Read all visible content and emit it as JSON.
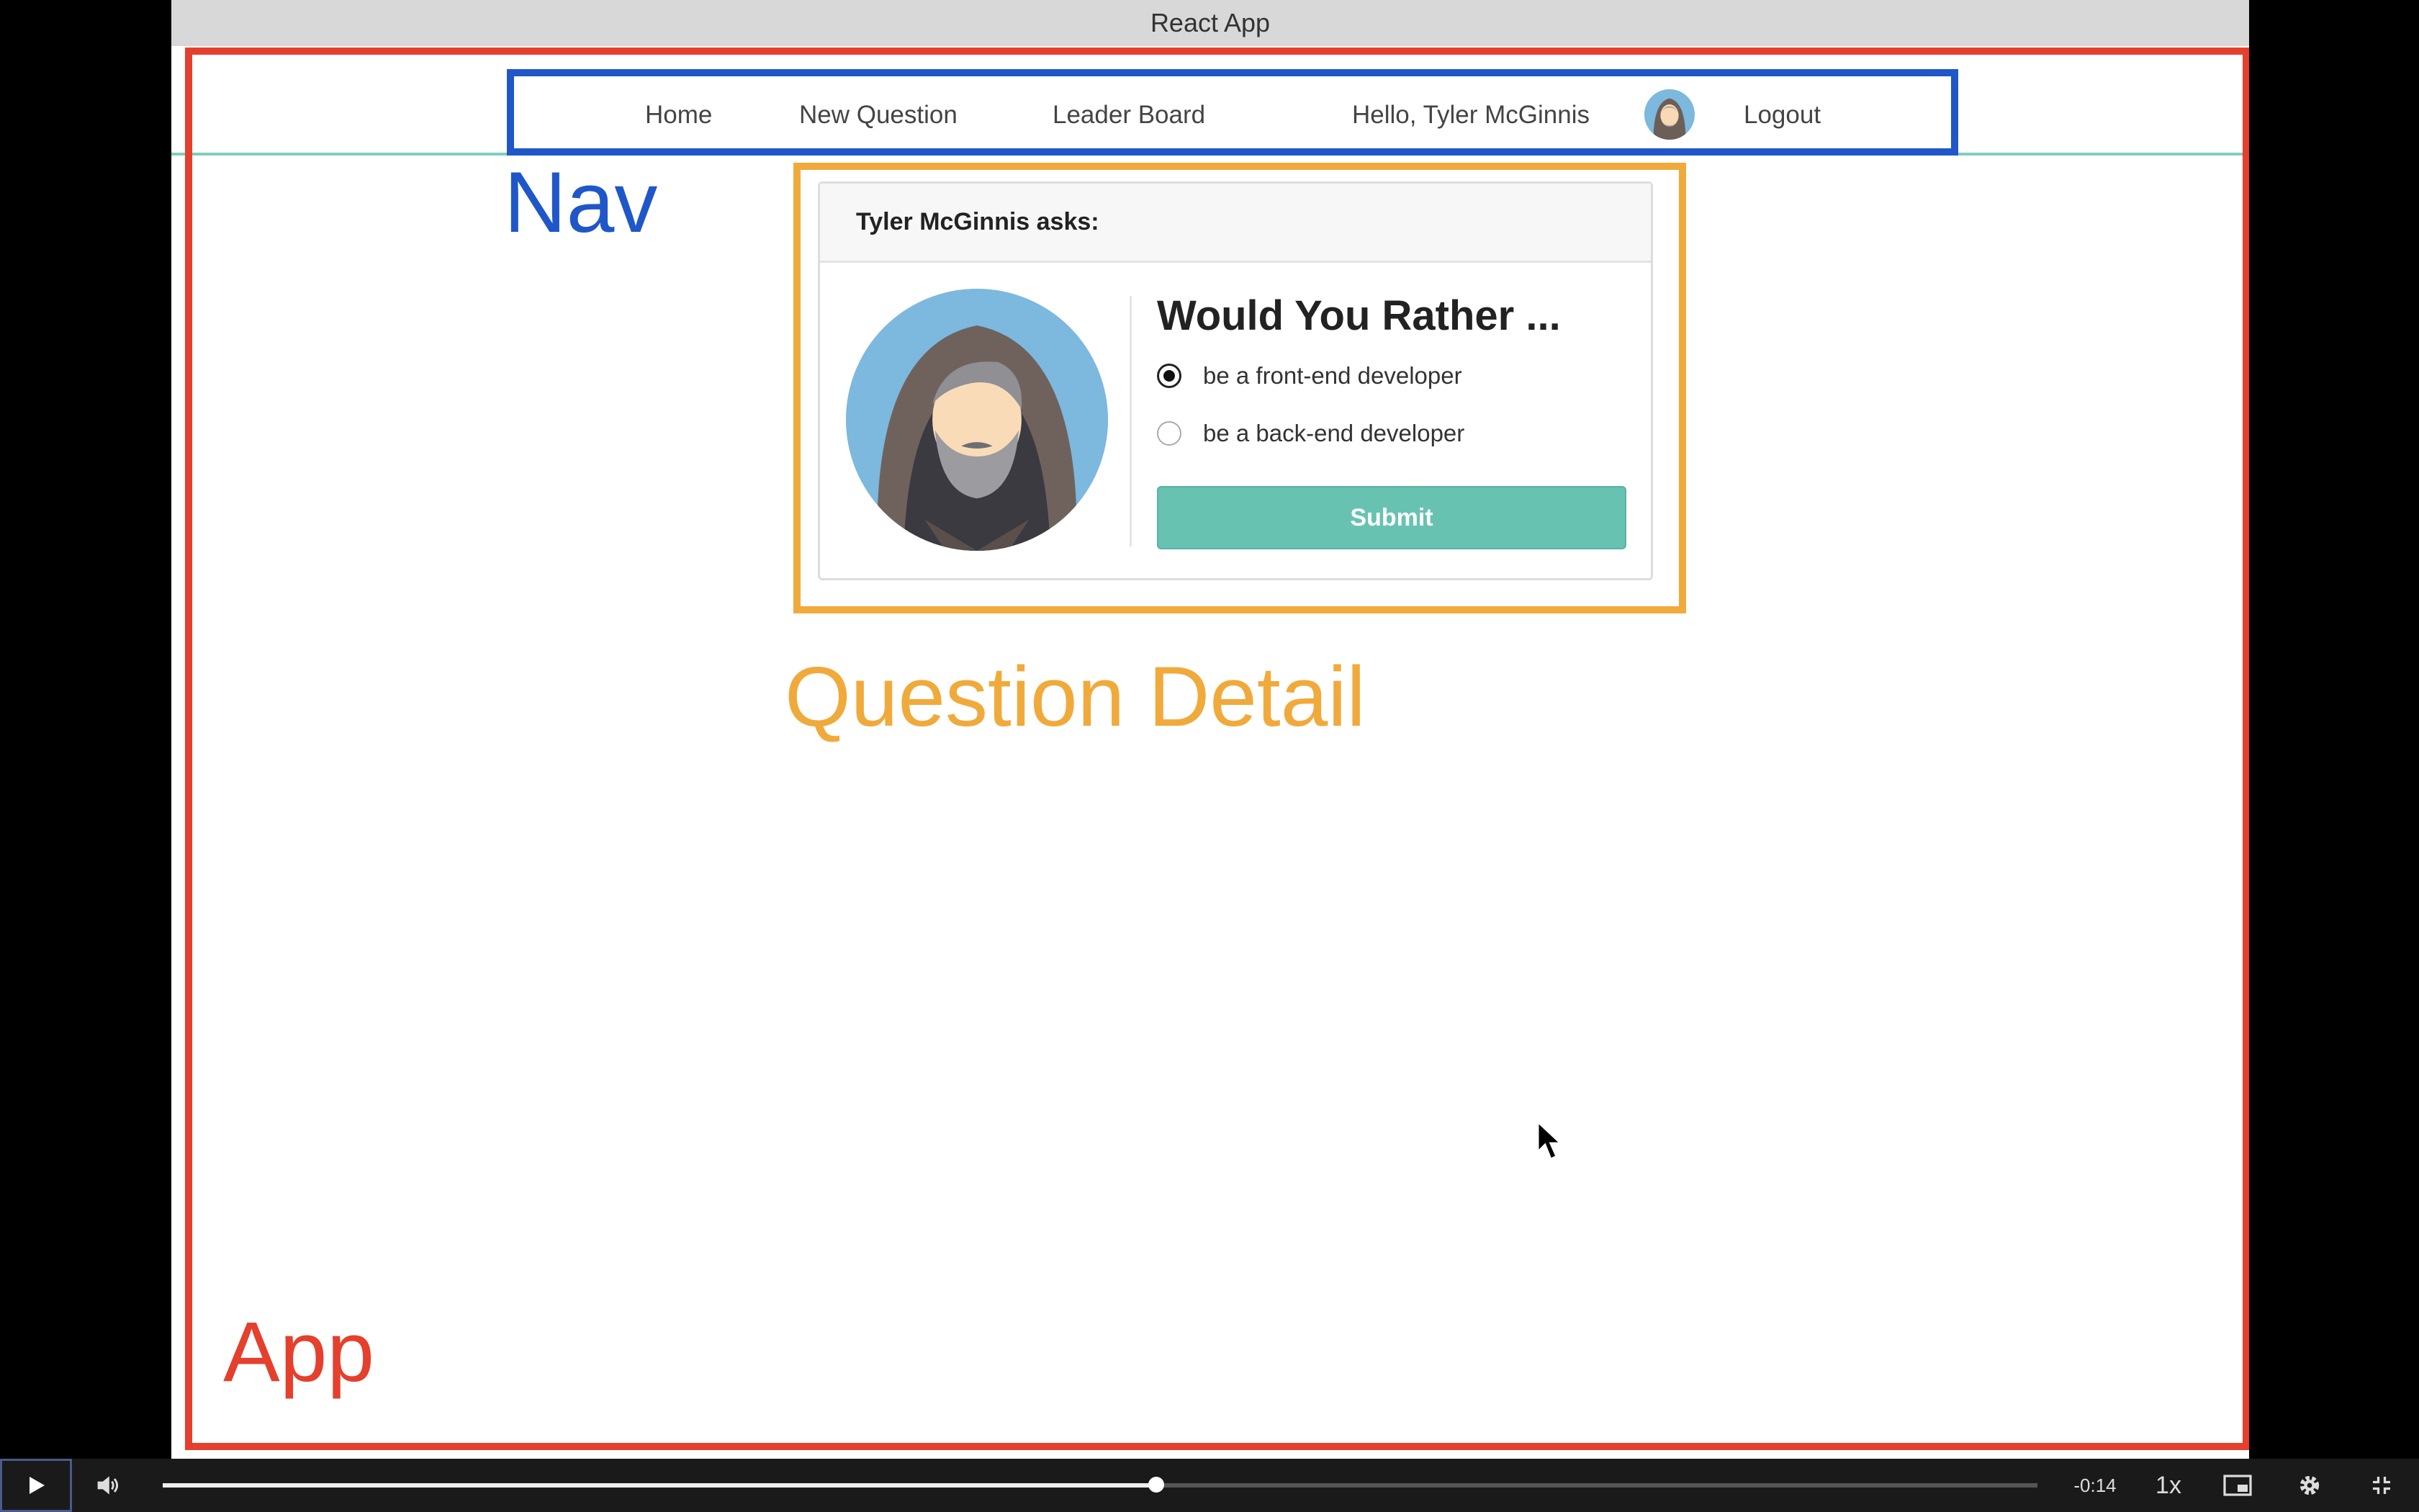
{
  "window": {
    "title": "React App"
  },
  "nav": {
    "items": [
      {
        "label": "Home"
      },
      {
        "label": "New Question"
      },
      {
        "label": "Leader Board"
      }
    ],
    "greeting": "Hello, Tyler McGinnis",
    "logout_label": "Logout"
  },
  "question": {
    "asker_header": "Tyler McGinnis asks:",
    "title": "Would You Rather ...",
    "options": [
      {
        "label": "be a front-end developer",
        "selected": true
      },
      {
        "label": "be a back-end developer",
        "selected": false
      }
    ],
    "submit_label": "Submit"
  },
  "annotations": {
    "nav_label": "Nav",
    "question_detail_label": "Question Detail",
    "app_label": "App",
    "colors": {
      "app": "#e4402d",
      "nav": "#1f57c9",
      "question_detail": "#f0aa3c"
    }
  },
  "player": {
    "time_remaining": "-0:14",
    "speed": "1x",
    "progress": 0.53,
    "icons": [
      "play-icon",
      "volume-icon",
      "picture-in-picture-icon",
      "settings-icon",
      "exit-fullscreen-icon"
    ]
  }
}
